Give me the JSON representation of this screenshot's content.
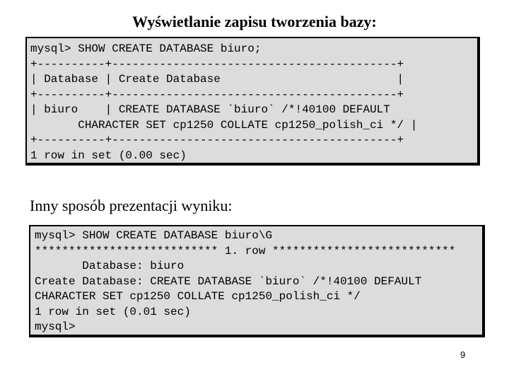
{
  "slide": {
    "title": "Wyświetlanie zapisu tworzenia bazy:",
    "subtitle": "Inny sposób prezentacji wyniku:",
    "page_number": "9"
  },
  "terminal1": {
    "lines": [
      "mysql> SHOW CREATE DATABASE biuro;",
      "+----------+------------------------------------------+",
      "| Database | Create Database                          |",
      "+----------+------------------------------------------+",
      "| biuro    | CREATE DATABASE `biuro` /*!40100 DEFAULT",
      "       CHARACTER SET cp1250 COLLATE cp1250_polish_ci */ |",
      "+----------+------------------------------------------+",
      "1 row in set (0.00 sec)"
    ]
  },
  "terminal2": {
    "lines": [
      "mysql> SHOW CREATE DATABASE biuro\\G",
      "*************************** 1. row ***************************",
      "       Database: biuro",
      "Create Database: CREATE DATABASE `biuro` /*!40100 DEFAULT",
      "CHARACTER SET cp1250 COLLATE cp1250_polish_ci */",
      "1 row in set (0.01 sec)",
      "mysql>"
    ]
  }
}
